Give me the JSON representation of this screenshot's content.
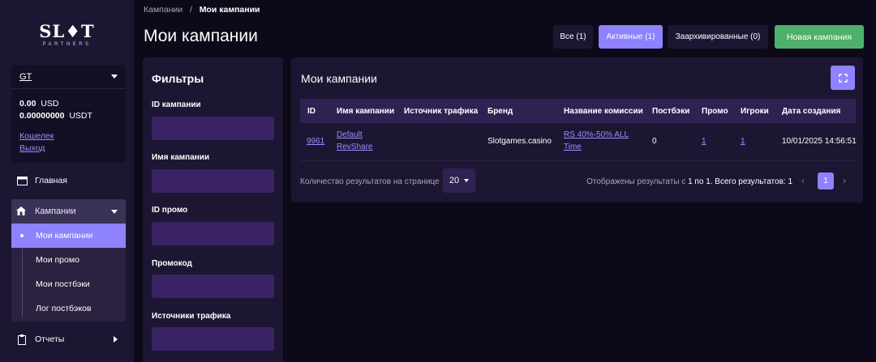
{
  "logo": {
    "main": "SL♦T",
    "sub": "PARTNERS"
  },
  "account": {
    "name": "GT",
    "balance_usd_value": "0.00",
    "balance_usd_cur": "USD",
    "balance_usdt_value": "0.00000000",
    "balance_usdt_cur": "USDT",
    "wallet_link": "Кошелек",
    "logout_link": "Выход"
  },
  "sidebar": {
    "home": "Главная",
    "campaigns": "Кампании",
    "sub_items": [
      "Мои кампании",
      "Мои промо",
      "Мои постбэки",
      "Лог постбэков"
    ],
    "reports": "Отчеты"
  },
  "breadcrumb": {
    "parent": "Кампании",
    "sep": "/",
    "current": "Мои кампании"
  },
  "page_title": "Мои кампании",
  "tabs": {
    "all": "Все (1)",
    "active": "Активные (1)",
    "archived": "Заархивированные (0)",
    "new": "Новая кампания"
  },
  "filters": {
    "title": "Фильтры",
    "fields": [
      "ID кампании",
      "Имя кампании",
      "ID промо",
      "Промокод",
      "Источники трафика"
    ]
  },
  "panel": {
    "title": "Мои кампании",
    "columns": [
      "ID",
      "Имя кампании",
      "Источник трафика",
      "Бренд",
      "Название комиссии",
      "Постбэки",
      "Промо",
      "Игроки",
      "Дата создания"
    ],
    "row": {
      "id": "9961",
      "name_line1": "Default",
      "name_line2": "RevShare",
      "source": "",
      "brand": "Slotgames.casino",
      "commission_line1": "RS 40%-50% ALL",
      "commission_line2": "Time",
      "postbacks": "0",
      "promo": "1",
      "players": "1",
      "created": "10/01/2025 14:56:51"
    },
    "footer": {
      "per_page_label": "Количество результатов на странице",
      "per_page_value": "20",
      "shown_prefix": "Отображены результаты с",
      "shown_from": "1",
      "shown_mid": "по",
      "shown_to": "1",
      "shown_total_label": ". Всего результатов:",
      "shown_total": "1",
      "prev": "‹",
      "page": "1",
      "next": "›"
    }
  },
  "colors": {
    "accent": "#8e82ff",
    "success": "#4fb06b",
    "panel": "#1d1632",
    "input": "#3a2364"
  }
}
